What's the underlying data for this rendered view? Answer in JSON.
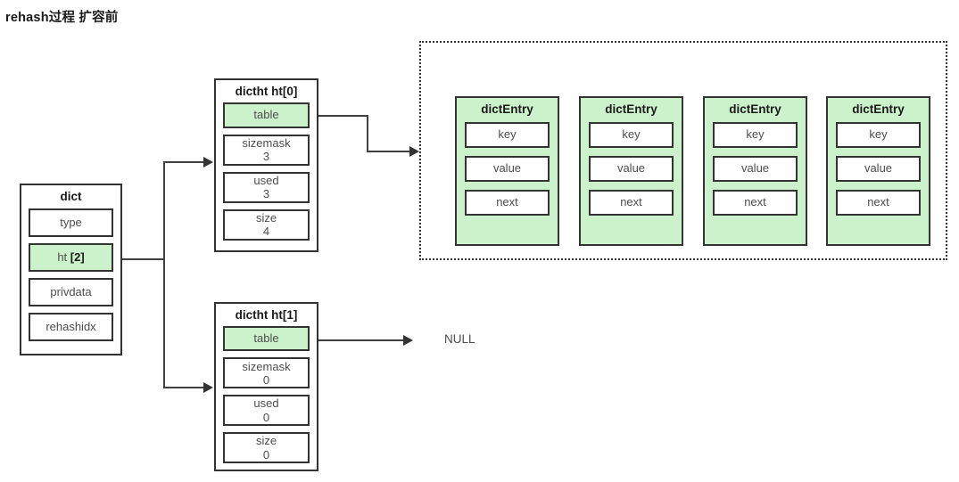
{
  "title": "rehash过程 扩容前",
  "colors": {
    "highlight_green": "#ccf2cc",
    "border": "#333333",
    "text": "#4d4d4d",
    "line": "#404040"
  },
  "dict": {
    "title": "dict",
    "fields": [
      {
        "name": "type",
        "value": "",
        "highlight": false
      },
      {
        "name": "ht ",
        "value": "",
        "suffix": "[2]",
        "highlight": true
      },
      {
        "name": "privdata",
        "value": "",
        "highlight": false
      },
      {
        "name": "rehashidx",
        "value": "",
        "highlight": false
      }
    ]
  },
  "dictht0": {
    "title": "dictht ht[0]",
    "fields": [
      {
        "name": "table",
        "value": "",
        "highlight": true
      },
      {
        "name": "sizemask",
        "value": "3",
        "highlight": false
      },
      {
        "name": "used",
        "value": "3",
        "highlight": false
      },
      {
        "name": "size",
        "value": "4",
        "highlight": false
      }
    ]
  },
  "dictht1": {
    "title": "dictht ht[1]",
    "fields": [
      {
        "name": "table",
        "value": "",
        "highlight": true
      },
      {
        "name": "sizemask",
        "value": "0",
        "highlight": false
      },
      {
        "name": "used",
        "value": "0",
        "highlight": false
      },
      {
        "name": "size",
        "value": "0",
        "highlight": false
      }
    ]
  },
  "entries": [
    {
      "title": "dictEntry",
      "fields": [
        "key",
        "value",
        "next"
      ]
    },
    {
      "title": "dictEntry",
      "fields": [
        "key",
        "value",
        "next"
      ]
    },
    {
      "title": "dictEntry",
      "fields": [
        "key",
        "value",
        "next"
      ]
    },
    {
      "title": "dictEntry",
      "fields": [
        "key",
        "value",
        "next"
      ]
    }
  ],
  "null_label": "NULL"
}
